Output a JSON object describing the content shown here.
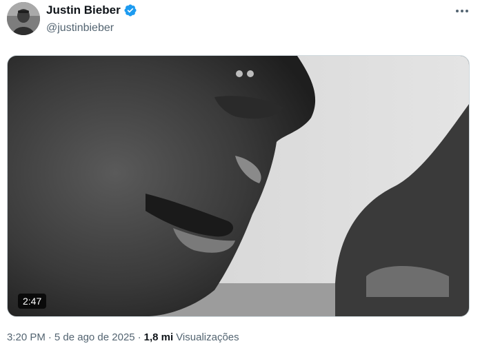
{
  "author": {
    "display_name": "Justin Bieber",
    "handle": "@justinbieber",
    "verified": true,
    "verified_color": "#1d9bf0"
  },
  "icons": {
    "more": "more-horizontal-icon",
    "verified": "verified-badge-icon"
  },
  "media": {
    "type": "video",
    "duration": "2:47"
  },
  "meta": {
    "time": "3:20 PM",
    "separator": "·",
    "date": "5 de ago de 2025",
    "views_count": "1,8 mi",
    "views_label": "Visualizações"
  }
}
